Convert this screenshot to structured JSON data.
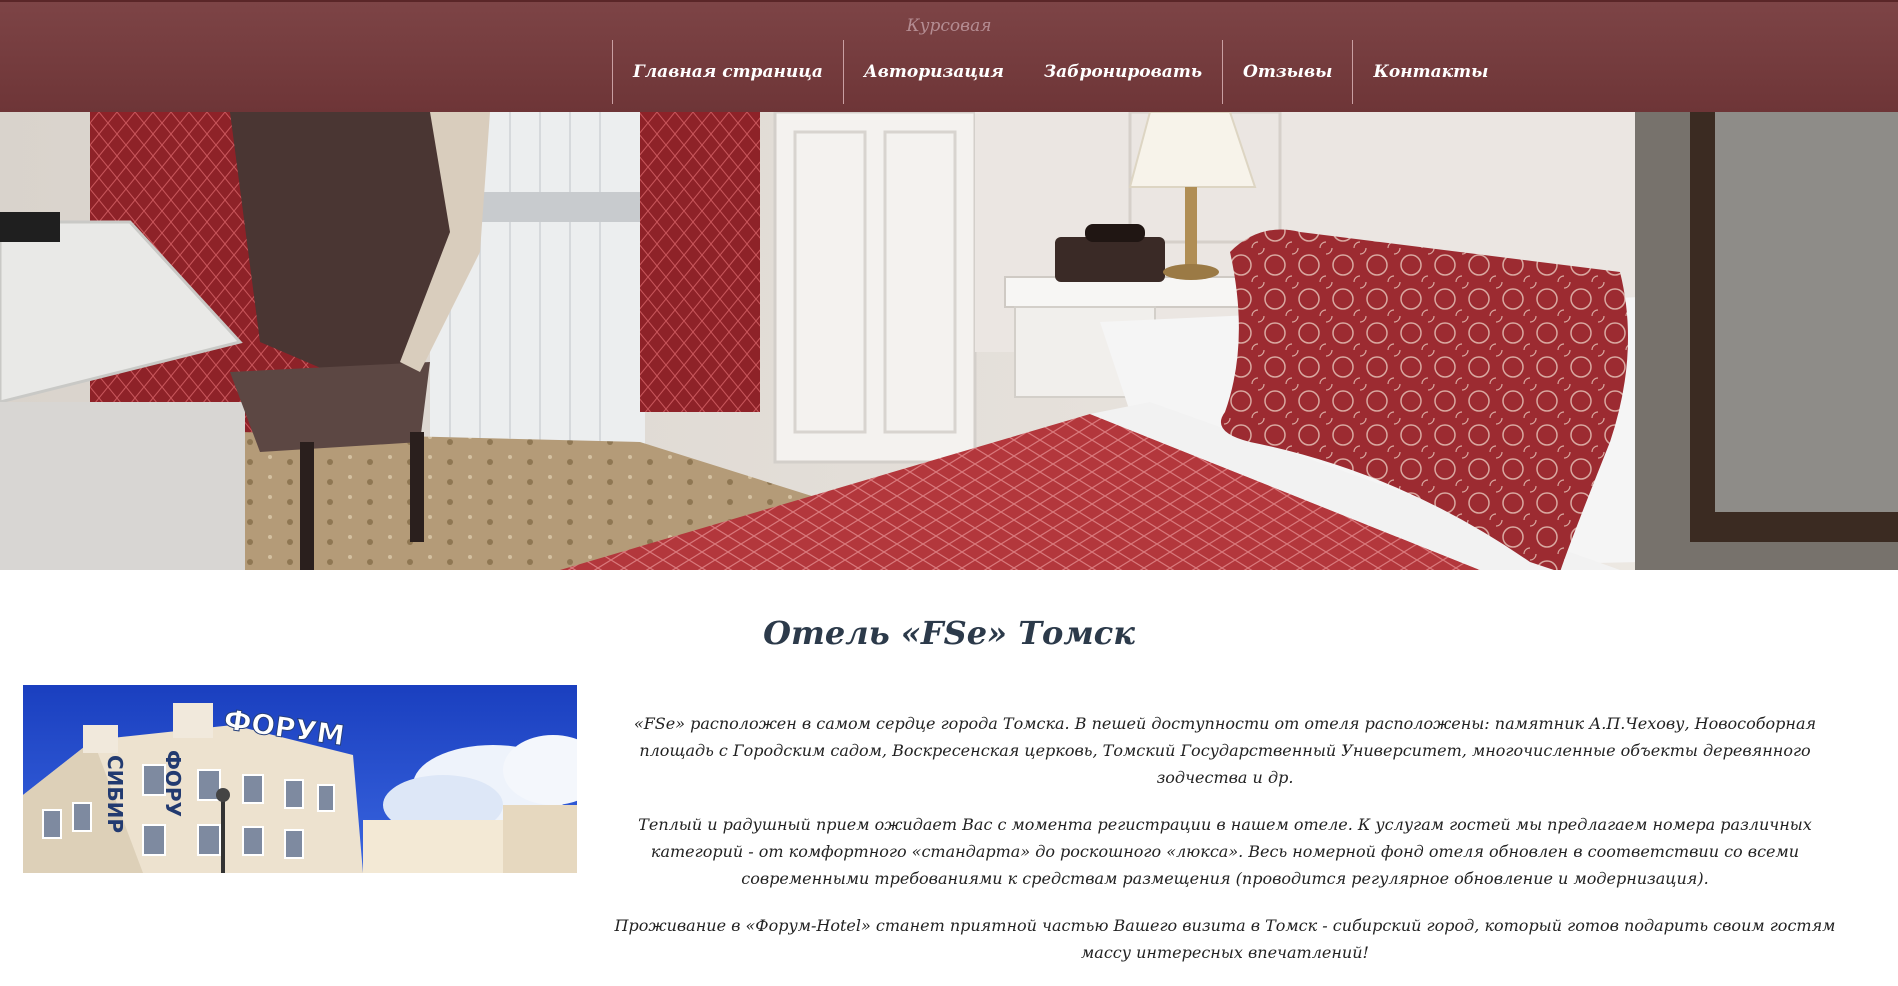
{
  "header": {
    "brand": "Курсовая",
    "nav": [
      {
        "label": "Главная страница"
      },
      {
        "label": "Авторизация"
      },
      {
        "label": "Забронировать"
      },
      {
        "label": "Отзывы"
      },
      {
        "label": "Контакты"
      }
    ]
  },
  "main": {
    "title": "Отель «FSe» Томск",
    "photo_sign_top": "ФОРУМ",
    "photo_sign_side_left": "СИБИР",
    "photo_sign_side_right": "ФОРУ",
    "paragraphs": [
      "«FSe» расположен в самом сердце города Томска. В пешей доступности от отеля расположены: памятник А.П.Чехову, Новособорная площадь с Городским садом, Воскресенская церковь, Томский Государственный Университет, многочисленные объекты деревянного зодчества и др.",
      "Теплый и радушный прием ожидает Вас с момента регистрации в нашем отеле. К услугам гостей мы предлагаем номера различных категорий - от комфортного «стандарта» до роскошного «люкса». Весь номерной фонд отеля обновлен в соответствии со всеми современными требованиями к средствам размещения (проводится регулярное обновление и модернизация).",
      "Проживание в «Форум-Hotel» станет приятной частью Вашего визита в Томск - сибирский город, который готов подарить своим гостям массу интересных впечатлений!"
    ]
  },
  "colors": {
    "header_bg": "#7a4143",
    "nav_text": "#ffffff",
    "title_text": "#2c3a4a",
    "bedspread_red": "#b33a3e"
  }
}
